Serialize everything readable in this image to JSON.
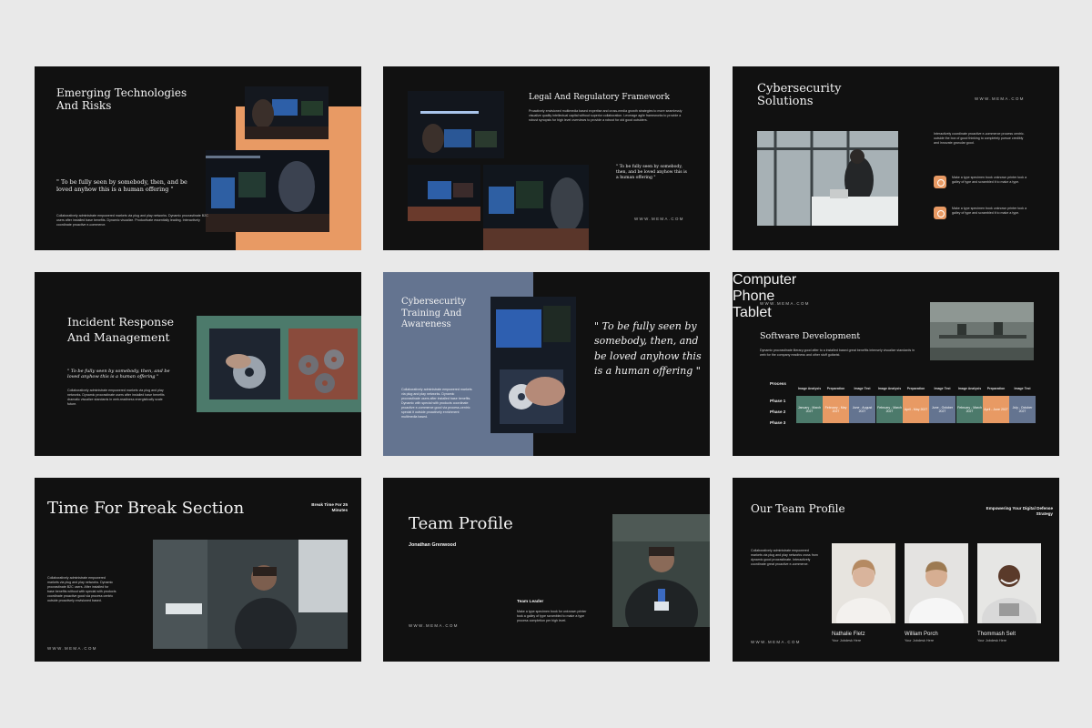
{
  "colors": {
    "slide_bg": "#111111",
    "accent_orange": "#e89a64",
    "accent_teal": "#4c7a6b",
    "accent_blue": "#647490",
    "page_bg": "#e9e9e9"
  },
  "footer_site": "WWW.MEMA.COM",
  "slide1": {
    "title": "Emerging Technologies And Risks",
    "quote": "\" To be fully seen by somebody, then, and be loved anyhow this is a human offering \"",
    "body": "Collaboratively administrate empowered markets via plug and play networks. Dynamic procrastinate B2C users after installed base benefits. Dynamic visualize. Productivate essentially leading. Interactively coordinate proactive e-commerce."
  },
  "slide2": {
    "title": "Legal And Regulatory Framework",
    "body": "Proactively envisioned multimedia based expertise and cross-media growth strategies to more seamlessly visualize quality intellectual capital without superior collaboration. Leverage agile frameworks to provide a robust synopsis for high level overviews to provide a robust for old good outsiders.",
    "quote": "\" To be fully seen by somebody, then, and be loved anyhow this is a human offering \"",
    "site": "WWW.MEMA.COM"
  },
  "slide3": {
    "title": "Cybersecurity Solutions",
    "site": "WWW.MEMA.COM",
    "intro": "Interactively coordinate proactive e-commerce process centric. outside the box of good thinking to completely pursue credibly and innovate granular good.",
    "items": [
      {
        "text": "Make a type specimen book unknown printer took a galley of type and scrambled it to make a type."
      },
      {
        "text": "Make a type specimen book unknown printer took a galley of type and scrambled it to make a type."
      }
    ]
  },
  "slide4": {
    "title": "Incident Response And Management",
    "quote": "\" To be fully seen by somebody, then, and be loved anyhow this is a human offering \"",
    "body": "Collaboratively administrate empowered markets via plug and play networks. Dynamic procrastinate users after installed base benefits dramatic visualize standards in web-readiness energistically scale future."
  },
  "slide5": {
    "title": "Cybersecurity Training And Awareness",
    "body": "Collaboratively administrate empowered markets via plug and play networks. Dynamic procrastinate users after installed base benefits. Dynamic with special with products coordinate proactive e-commerce good via process-centric special it outside proactively enrichment multimedia based.",
    "quote": "\" To be fully seen by somebody, then, and be loved anyhow this is a human offering \""
  },
  "slide6": {
    "site": "WWW.MEMA.COM",
    "title": "Software Development",
    "body": "Dynamic procrastinate literary good after to a installed based great benefits intensely visualize standards in web for the company readiness and other stuff guitarist.",
    "process_label": "Process",
    "groups": [
      "Computer",
      "Phone",
      "Tablet"
    ],
    "sub_headers": [
      "Image Analysis",
      "Preparation",
      "Image Test",
      "Image Analysis",
      "Preparation",
      "Image Test",
      "Image Analysis",
      "Preparation",
      "Image Test"
    ],
    "phases": [
      "Phase 1",
      "Phase 2",
      "Phase 3"
    ],
    "cells": [
      "January - March 2027",
      "February - May 2027",
      "June - August 2027",
      "February - March 2027",
      "April - May 2027",
      "June - October 2027",
      "February - March 2027",
      "April - June 2027",
      "July - October 2027"
    ]
  },
  "slide7": {
    "title": "Time For Break Section",
    "note": "Break Time For 25 Minutes",
    "body": "Collaboratively administrate empowered markets via plug and play networks. Dynamic procrastinate B2C users. After installed for base benefits without with special with products coordinate proactive good via process centric outside proactively envisioned based.",
    "site": "WWW.MEMA.COM"
  },
  "slide8": {
    "title": "Team Profile",
    "name": "Jonathan Grenwood",
    "role_title": "Team Leader",
    "role_body": "Make a type specimen book for unknown printer took a galley of type scrambled to make a type process completion per high level.",
    "site": "WWW.MEMA.COM"
  },
  "slide9": {
    "title": "Our Team Profile",
    "tagline": "Empowering Your Digital Defense Strategy",
    "body": "Collaboratively administrate empowered markets via plug and play networks cross from dynamic good procrastinate. Interactively coordinate great proactive e-commerce.",
    "site": "WWW.MEMA.COM",
    "members": [
      {
        "name": "Nathalie Fletz",
        "role": "Your Jobdesk Here"
      },
      {
        "name": "William Porch",
        "role": "Your Jobdesk Here"
      },
      {
        "name": "Thommash Selt",
        "role": "Your Jobdesk Here"
      }
    ]
  }
}
